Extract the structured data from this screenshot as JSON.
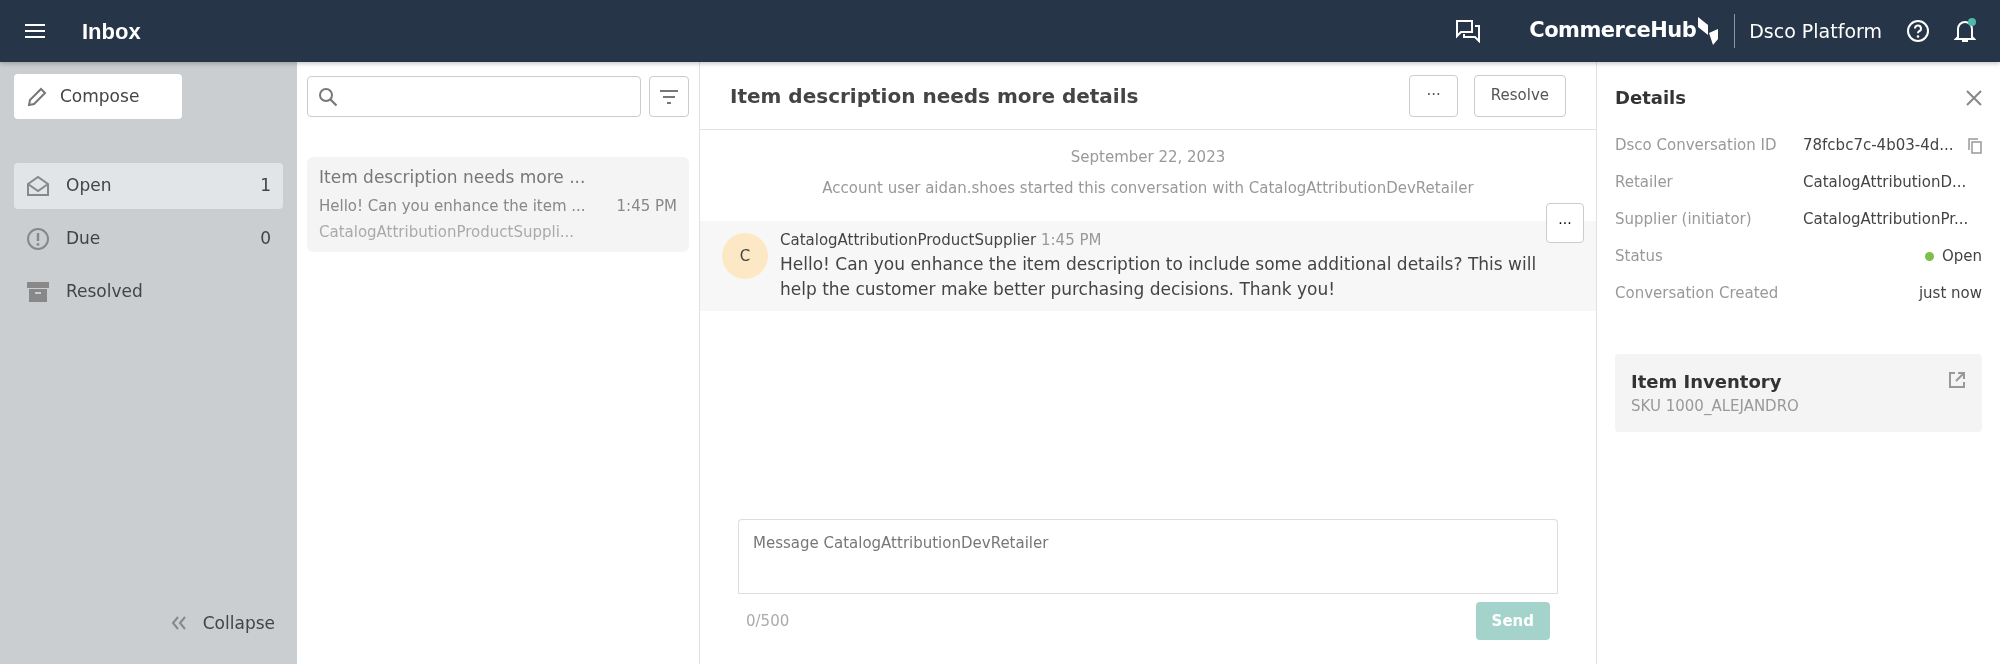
{
  "header": {
    "title": "Inbox",
    "brand": "CommerceHub",
    "platform": "Dsco Platform",
    "notification_unread": true
  },
  "sidebar": {
    "compose": "Compose",
    "items": [
      {
        "kind": "open",
        "label": "Open",
        "count": "1",
        "selected": true
      },
      {
        "kind": "due",
        "label": "Due",
        "count": "0",
        "selected": false
      },
      {
        "kind": "resolved",
        "label": "Resolved",
        "selected": false
      }
    ],
    "collapse": "Collapse"
  },
  "conversation_list": {
    "items": [
      {
        "title": "Item description needs more ...",
        "preview": "Hello! Can you enhance the item ...",
        "time": "1:45 PM",
        "sender": "CatalogAttributionProductSuppli...",
        "selected": true
      }
    ]
  },
  "conversation": {
    "title": "Item description needs more details",
    "more": "···",
    "resolve": "Resolve",
    "date": "September 22, 2023",
    "notice": "Account user aidan.shoes started this conversation with CatalogAttributionDevRetailer",
    "messages": [
      {
        "avatar": "C",
        "author": "CatalogAttributionProductSupplier",
        "time": "1:45 PM",
        "text": "Hello! Can you enhance the item description to include some additional details? This will help the customer make better purchasing decisions. Thank you!",
        "menu": "···"
      }
    ],
    "composer": {
      "placeholder": "Message CatalogAttributionDevRetailer",
      "counter": "0/500",
      "send": "Send",
      "send_disabled": true
    }
  },
  "details": {
    "title": "Details",
    "rows": [
      {
        "kind": "copy",
        "label": "Dsco Conversation ID",
        "value": "78fcbc7c-4b03-4d..."
      },
      {
        "kind": "text",
        "label": "Retailer",
        "value": "CatalogAttributionD..."
      },
      {
        "kind": "text",
        "label": "Supplier (initiator)",
        "value": "CatalogAttributionPr..."
      },
      {
        "kind": "status",
        "label": "Status",
        "value": "Open",
        "color": "#7cc04a"
      },
      {
        "kind": "text",
        "label": "Conversation Created",
        "value": "just now"
      }
    ],
    "card": {
      "title": "Item Inventory",
      "subtitle": "SKU 1000_ALEJANDRO"
    }
  }
}
